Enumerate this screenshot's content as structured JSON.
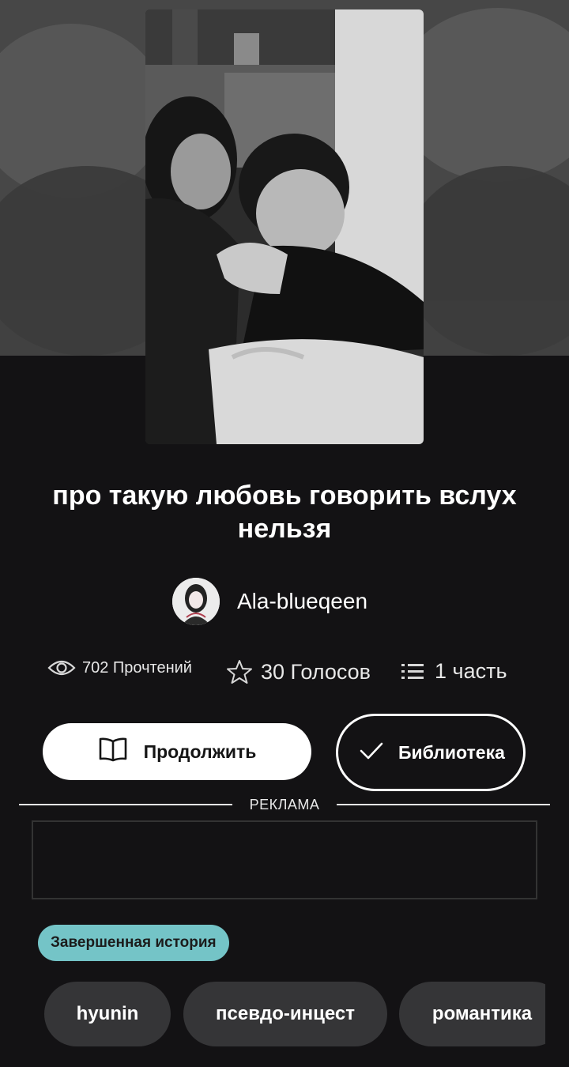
{
  "story": {
    "title": "про такую любовь говорить вслух нельзя",
    "author": {
      "name": "Ala-blueqeen"
    },
    "stats": {
      "reads": "702 Прочтений",
      "votes": "30 Голосов",
      "parts": "1 часть"
    },
    "actions": {
      "continue_label": "Продолжить",
      "library_label": "Библиотека"
    },
    "ad_label": "РЕКЛАМА",
    "status_badge": "Завершенная история",
    "tags": [
      "hyunin",
      "псевдо-инцест",
      "романтика"
    ]
  },
  "colors": {
    "background": "#131214",
    "badge": "#74c4c7",
    "tag_bg": "#353537"
  },
  "icons": [
    "eye-icon",
    "star-icon",
    "list-icon",
    "book-icon",
    "check-icon"
  ]
}
